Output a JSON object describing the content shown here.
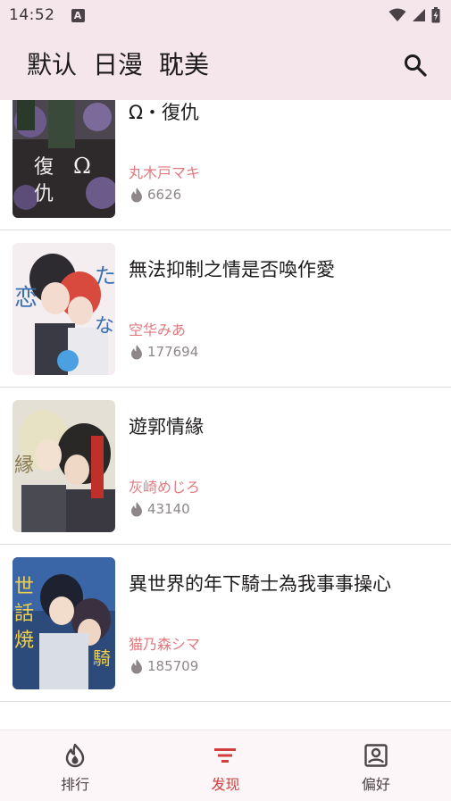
{
  "status_bar": {
    "time": "14:52",
    "notification_glyph": "A"
  },
  "header": {
    "tabs": [
      {
        "label": "默认"
      },
      {
        "label": "日漫"
      },
      {
        "label": "耽美"
      }
    ],
    "search_icon": "search-icon"
  },
  "comics": [
    {
      "title": "Ω・復仇",
      "author": "丸木戸マキ",
      "hot": "6626"
    },
    {
      "title": "無法抑制之情是否喚作愛",
      "author": "空华みあ",
      "hot": "177694"
    },
    {
      "title": "遊郭情緣",
      "author": "灰崎めじろ",
      "hot": "43140"
    },
    {
      "title": "異世界的年下騎士為我事事操心",
      "author": "猫乃森シマ",
      "hot": "185709"
    }
  ],
  "bottom_nav": {
    "items": [
      {
        "label": "排行",
        "icon": "flame-icon",
        "active": false
      },
      {
        "label": "发现",
        "icon": "filter-icon",
        "active": true
      },
      {
        "label": "偏好",
        "icon": "account-box-icon",
        "active": false
      }
    ]
  },
  "colors": {
    "header_bg": "#f5e6ec",
    "author": "#e07a80",
    "active_nav": "#d23d3d",
    "divider": "#e2dadd"
  }
}
